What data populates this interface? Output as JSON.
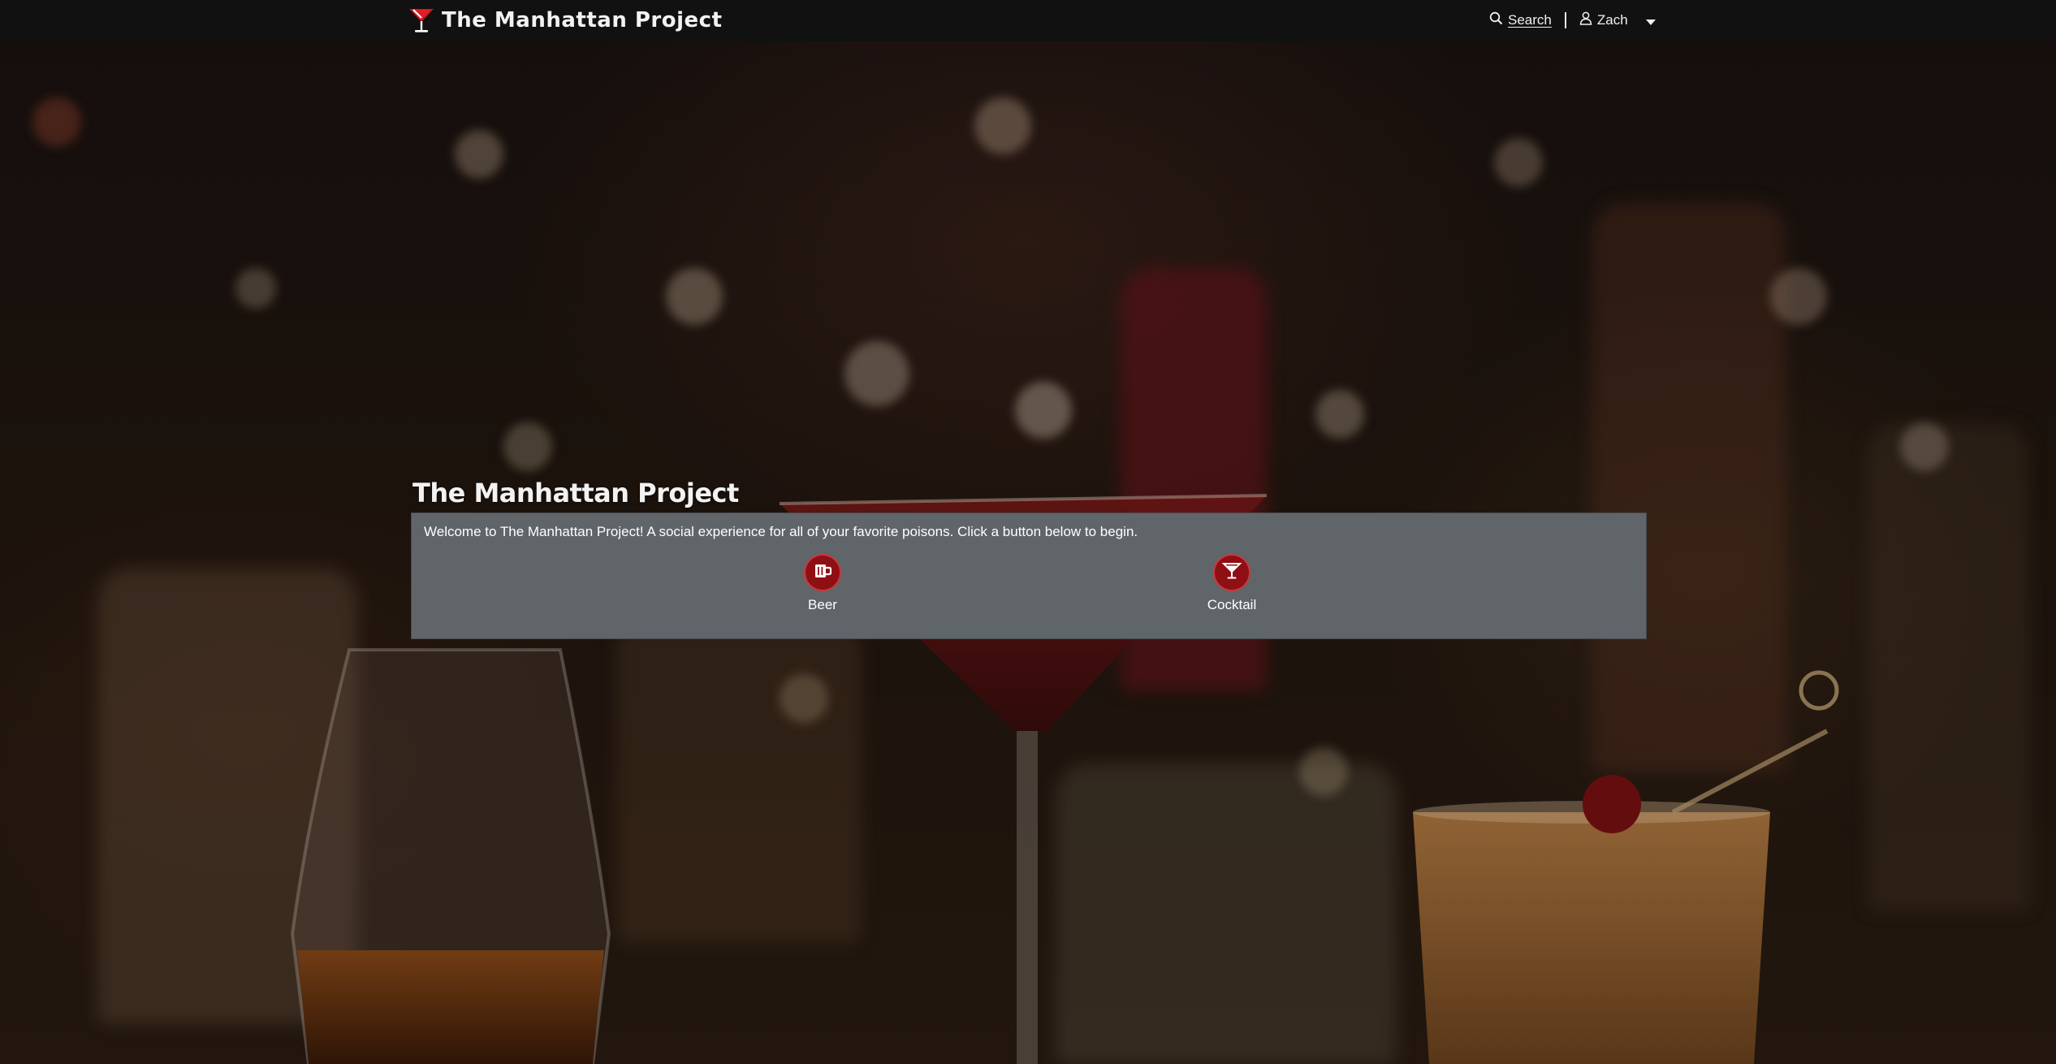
{
  "navbar": {
    "brand": "The Manhattan Project",
    "brand_icon": "martini-glass-icon",
    "search_label": "Search",
    "search_icon": "search-icon",
    "user_name": "Zach",
    "user_icon": "user-icon",
    "user_menu_icon": "caret-down-icon"
  },
  "main": {
    "heading": "The Manhattan Project",
    "welcome_text": "Welcome to The Manhattan Project! A social experience for all of your favorite poisons. Click a button below to begin.",
    "choices": [
      {
        "label": "Beer",
        "icon": "beer-mug-icon"
      },
      {
        "label": "Cocktail",
        "icon": "cocktail-glass-icon"
      }
    ]
  },
  "colors": {
    "navbar_bg": "#111111",
    "panel_bg": "#5f6569",
    "accent_red": "#8e0f14",
    "text": "#ffffff"
  }
}
